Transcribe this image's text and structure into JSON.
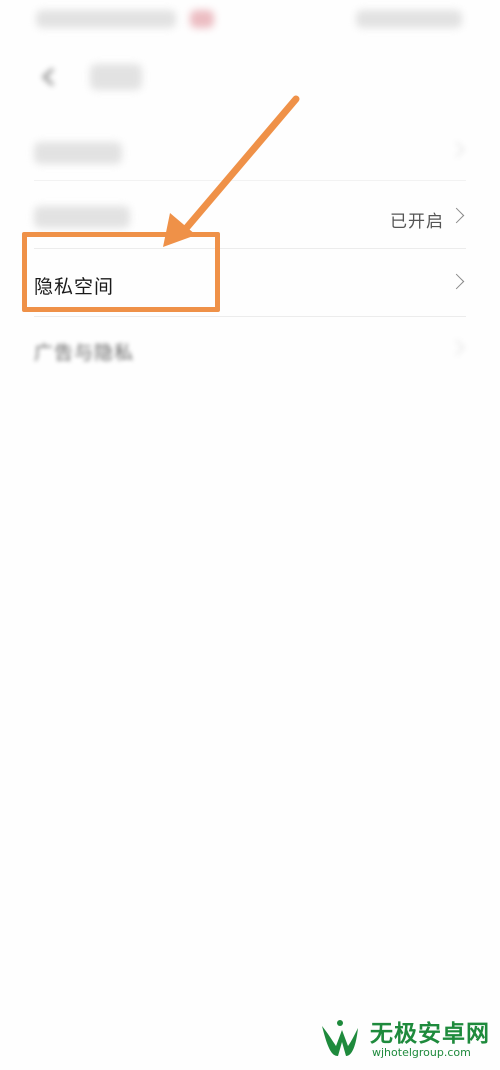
{
  "settings_list": {
    "rows": [
      {
        "label": "",
        "value": ""
      },
      {
        "label": "",
        "value": "已开启"
      },
      {
        "label": "隐私空间",
        "value": ""
      },
      {
        "label": "广告与隐私",
        "value": ""
      }
    ]
  },
  "annotation": {
    "color": "#ef9148"
  },
  "watermark": {
    "title": "无极安卓网",
    "url": "wjhotelgroup.com",
    "brand_color": "#1e8a3c",
    "icon": "w-logo-icon"
  }
}
